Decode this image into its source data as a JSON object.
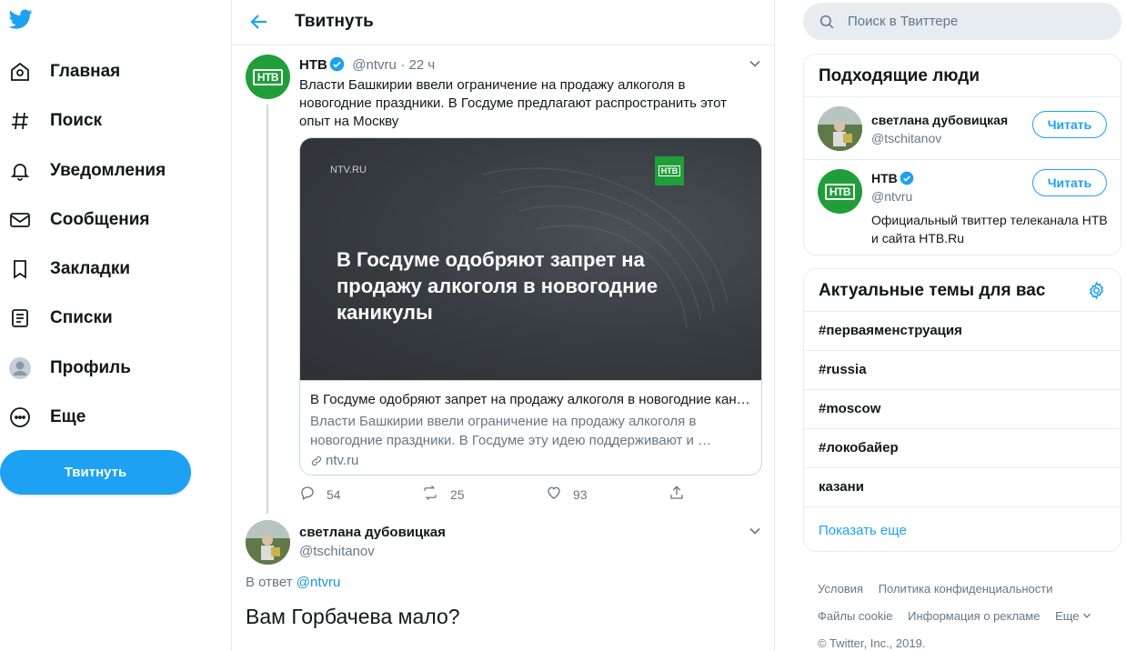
{
  "nav": {
    "items": [
      {
        "label": "Главная",
        "icon": "home-icon"
      },
      {
        "label": "Поиск",
        "icon": "hashtag-icon"
      },
      {
        "label": "Уведомления",
        "icon": "bell-icon"
      },
      {
        "label": "Сообщения",
        "icon": "envelope-icon"
      },
      {
        "label": "Закладки",
        "icon": "bookmark-icon"
      },
      {
        "label": "Списки",
        "icon": "list-icon"
      },
      {
        "label": "Профиль",
        "icon": "profile-icon"
      },
      {
        "label": "Еще",
        "icon": "more-icon"
      }
    ],
    "tweet_button": "Твитнуть"
  },
  "header": {
    "title": "Твитнуть"
  },
  "tweet": {
    "author": "НТВ",
    "handle": "@ntvru",
    "time": "· 22 ч",
    "text": "Власти Башкирии ввели ограничение на продажу алкоголя в новогодние праздники. В Госдуме предлагают распространить этот опыт на Москву",
    "card": {
      "source_label": "NTV.RU",
      "headline": "В Госдуме одобряют запрет на продажу алкоголя в новогодние каникулы",
      "title": "В Госдуме одобряют запрет на продажу алкоголя в новогодние каникулы",
      "description": "Власти Башкирии ввели ограничение на продажу алкоголя в новогодние праздники. В Госдуме эту идею поддерживают и …",
      "link": "ntv.ru"
    },
    "replies": "54",
    "retweets": "25",
    "likes": "93"
  },
  "reply": {
    "author": "светлана дубовицкая",
    "handle": "@tschitanov",
    "reply_to_prefix": "В ответ",
    "reply_to_handle": "@ntvru",
    "text": "Вам Горбачева мало?"
  },
  "search": {
    "placeholder": "Поиск в Твиттере"
  },
  "who_to_follow": {
    "title": "Подходящие люди",
    "people": [
      {
        "name": "светлана дубовицкая",
        "handle": "@tschitanov",
        "button": "Читать"
      },
      {
        "name": "НТВ",
        "handle": "@ntvru",
        "button": "Читать",
        "bio": "Официальный твиттер телеканала НТВ и сайта НТВ.Ru"
      }
    ]
  },
  "trends": {
    "title": "Актуальные темы для вас",
    "items": [
      "#первая​менструация",
      "#russia",
      "#moscow",
      "#локобайер",
      "казани"
    ],
    "show_more": "Показать еще"
  },
  "footer": {
    "links": [
      "Условия",
      "Политика конфиденциальности",
      "Файлы cookie",
      "Информация о рекламе",
      "Еще"
    ],
    "copyright": "© Twitter, Inc., 2019."
  },
  "colors": {
    "accent": "#1da1f2",
    "ntv_green": "#1f9e3a",
    "muted": "#657786"
  }
}
